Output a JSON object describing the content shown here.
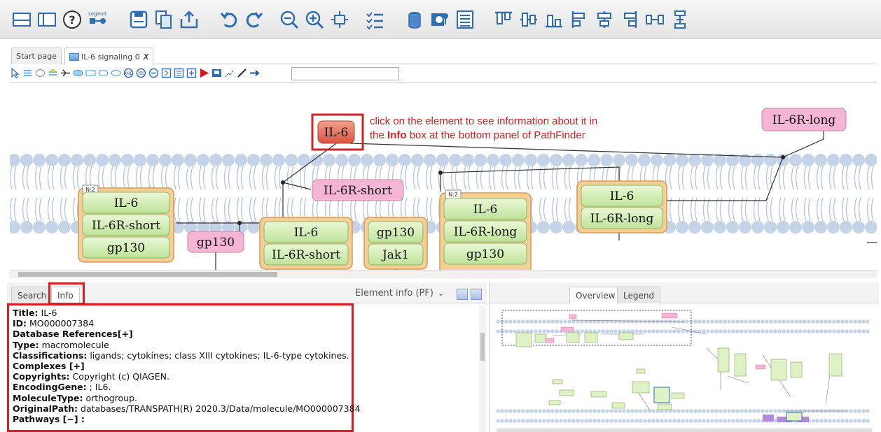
{
  "toolbar": {
    "legend_label": "Legend",
    "icons": [
      "layout-icon",
      "panel-icon",
      "help-icon",
      "legend-icon",
      "save-icon",
      "copy-icon",
      "export-icon",
      "undo-icon",
      "redo-icon",
      "zoom-out-icon",
      "zoom-in-icon",
      "fit-icon",
      "checklist-icon",
      "database-icon",
      "search-node-icon",
      "list-icon",
      "align-top-icon",
      "align-center-h-icon",
      "align-bottom-icon",
      "align-left-icon",
      "align-center-v-icon",
      "align-right-icon",
      "distribute-h-icon",
      "distribute-v-icon"
    ]
  },
  "tabs": [
    {
      "label": "Start page"
    },
    {
      "label": "IL-6 signaling 0",
      "close": "X"
    }
  ],
  "canvas": {
    "annotation_line1": "click on the element to see information about it in",
    "annotation_line2_pre": "the ",
    "annotation_line2_bold": "Info",
    "annotation_line2_post": " box at the bottom panel of PathFinder",
    "il6_node": "IL-6",
    "il6r_long_node": "IL-6R-long",
    "il6r_short_node": "IL-6R-short",
    "gp130_node": "gp130",
    "complex1": {
      "badge": "N:2",
      "items": [
        "IL-6",
        "IL-6R-short",
        "gp130"
      ]
    },
    "complex2": {
      "items": [
        "IL-6",
        "IL-6R-short"
      ]
    },
    "complex3": {
      "items": [
        "gp130",
        "Jak1"
      ]
    },
    "complex4": {
      "badge": "N:2",
      "items": [
        "IL-6",
        "IL-6R-long",
        "gp130"
      ]
    },
    "complex5": {
      "items": [
        "IL-6",
        "IL-6R-long"
      ]
    }
  },
  "info_panel": {
    "tabs": [
      "Search",
      "Info"
    ],
    "select_value": "Element info (PF)",
    "fields": [
      {
        "key": "Title",
        "value": "IL-6"
      },
      {
        "key": "ID",
        "value": "MO000007384"
      },
      {
        "key": "Database References[+]",
        "value": ""
      },
      {
        "key": "Type",
        "value": "macromolecule"
      },
      {
        "key": "Classifications",
        "value": "ligands; cytokines; class XIII cytokines; IL-6-type cytokines."
      },
      {
        "key": "Complexes [+]",
        "value": ""
      },
      {
        "key": "Copyrights",
        "value": "Copyright (c) QIAGEN."
      },
      {
        "key": "EncodingGene",
        "value": "; IL6."
      },
      {
        "key": "MoleculeType",
        "value": "orthogroup."
      },
      {
        "key": "OriginalPath",
        "value": "databases/TRANSPATH(R) 2020.3/Data/molecule/MO000007384"
      },
      {
        "key": "Pathways [−] :",
        "value": ""
      }
    ]
  },
  "overview_panel": {
    "tabs": [
      "Overview",
      "Legend"
    ]
  },
  "colors": {
    "highlight": "#d32027",
    "node_red": "#e2705e",
    "node_pink": "#f2a6cc",
    "node_green": "#d6f0b4",
    "complex_orange": "#f2c88a",
    "membrane": "#c5d3e8"
  }
}
